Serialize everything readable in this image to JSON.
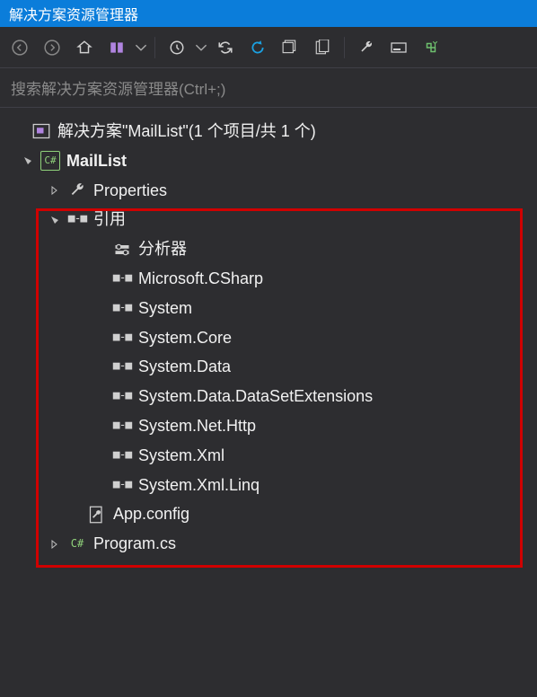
{
  "panel": {
    "title": "解决方案资源管理器"
  },
  "search": {
    "placeholder": "搜索解决方案资源管理器(Ctrl+;)"
  },
  "tree": {
    "solution_label": "解决方案\"MailList\"(1 个项目/共 1 个)",
    "project_label": "MailList",
    "properties_label": "Properties",
    "references_label": "引用",
    "analyzers_label": "分析器",
    "refs": [
      "Microsoft.CSharp",
      "System",
      "System.Core",
      "System.Data",
      "System.Data.DataSetExtensions",
      "System.Net.Http",
      "System.Xml",
      "System.Xml.Linq"
    ],
    "appconfig_label": "App.config",
    "program_label": "Program.cs"
  },
  "toolbar_semantic": [
    "back",
    "forward",
    "home",
    "switch-view",
    "dropdown",
    "history",
    "dropdown",
    "sync",
    "refresh",
    "collapse",
    "show-all",
    "props",
    "preview",
    "pending"
  ]
}
